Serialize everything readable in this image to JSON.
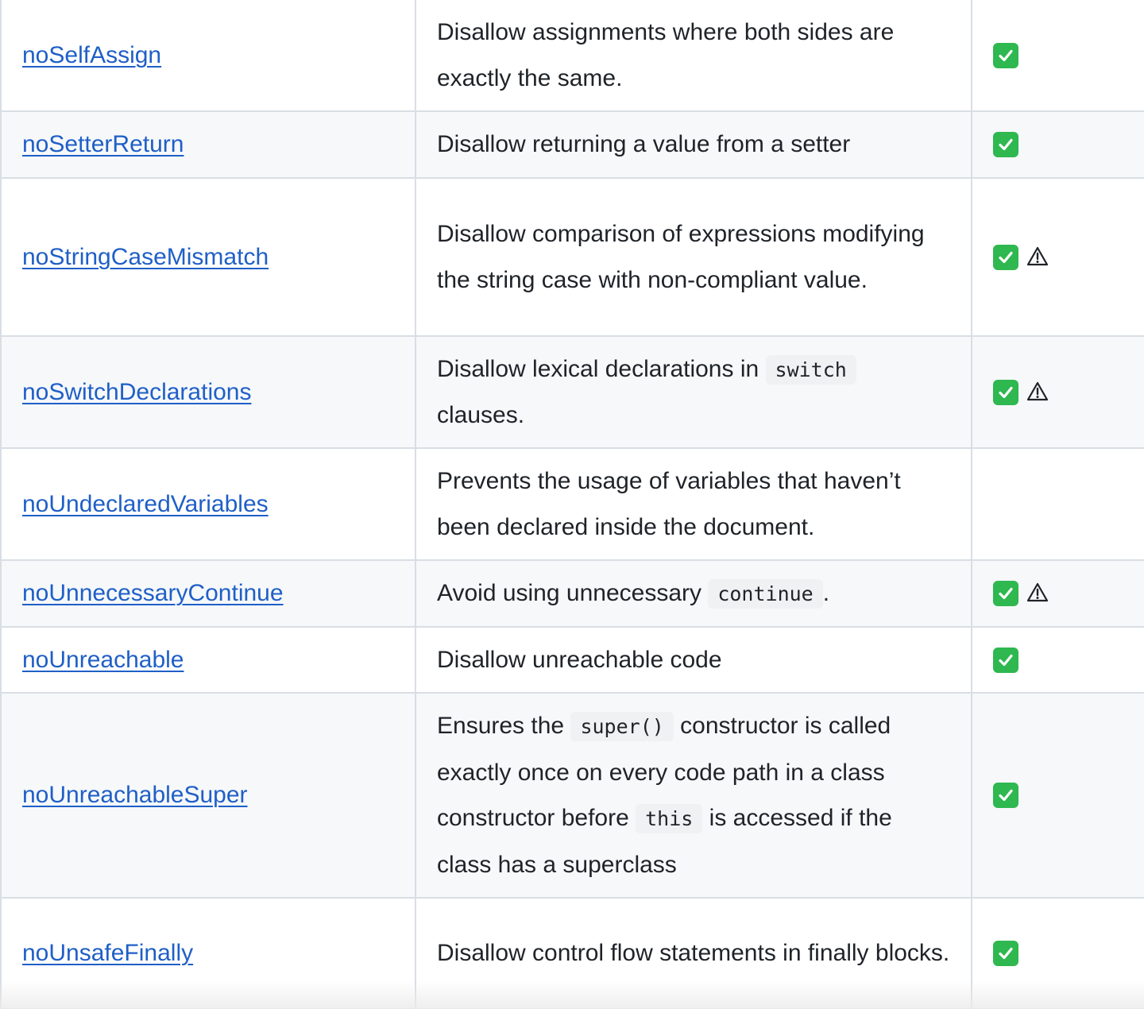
{
  "rules": [
    {
      "name": "noSelfAssign",
      "desc": [
        "Disallow assignments where both sides are exactly the same."
      ],
      "recommended": true,
      "fixable": false
    },
    {
      "name": "noSetterReturn",
      "desc": [
        "Disallow returning a value from a setter"
      ],
      "recommended": true,
      "fixable": false
    },
    {
      "name": "noStringCaseMismatch",
      "desc": [
        "Disallow comparison of expressions modifying the string case with non-compliant value."
      ],
      "recommended": true,
      "fixable": true
    },
    {
      "name": "noSwitchDeclarations",
      "desc": [
        "Disallow lexical declarations in ",
        {
          "code": "switch"
        },
        " clauses."
      ],
      "recommended": true,
      "fixable": true
    },
    {
      "name": "noUndeclaredVariables",
      "desc": [
        "Prevents the usage of variables that haven’t been declared inside the document."
      ],
      "recommended": false,
      "fixable": false
    },
    {
      "name": "noUnnecessaryContinue",
      "desc": [
        "Avoid using unnecessary ",
        {
          "code": "continue"
        },
        "."
      ],
      "recommended": true,
      "fixable": true
    },
    {
      "name": "noUnreachable",
      "desc": [
        "Disallow unreachable code"
      ],
      "recommended": true,
      "fixable": false
    },
    {
      "name": "noUnreachableSuper",
      "desc": [
        "Ensures the ",
        {
          "code": "super()"
        },
        " constructor is called exactly once on every code path in a class constructor before ",
        {
          "code": "this"
        },
        " is accessed if the class has a superclass"
      ],
      "recommended": true,
      "fixable": false
    },
    {
      "name": "noUnsafeFinally",
      "desc": [
        "Disallow control flow statements in finally blocks."
      ],
      "recommended": true,
      "fixable": false
    }
  ],
  "icons": {
    "recommended": "white-check-mark-icon",
    "fixable": "warning-icon",
    "check_color": "#2eb84f",
    "link_color": "#1f5fc7"
  }
}
